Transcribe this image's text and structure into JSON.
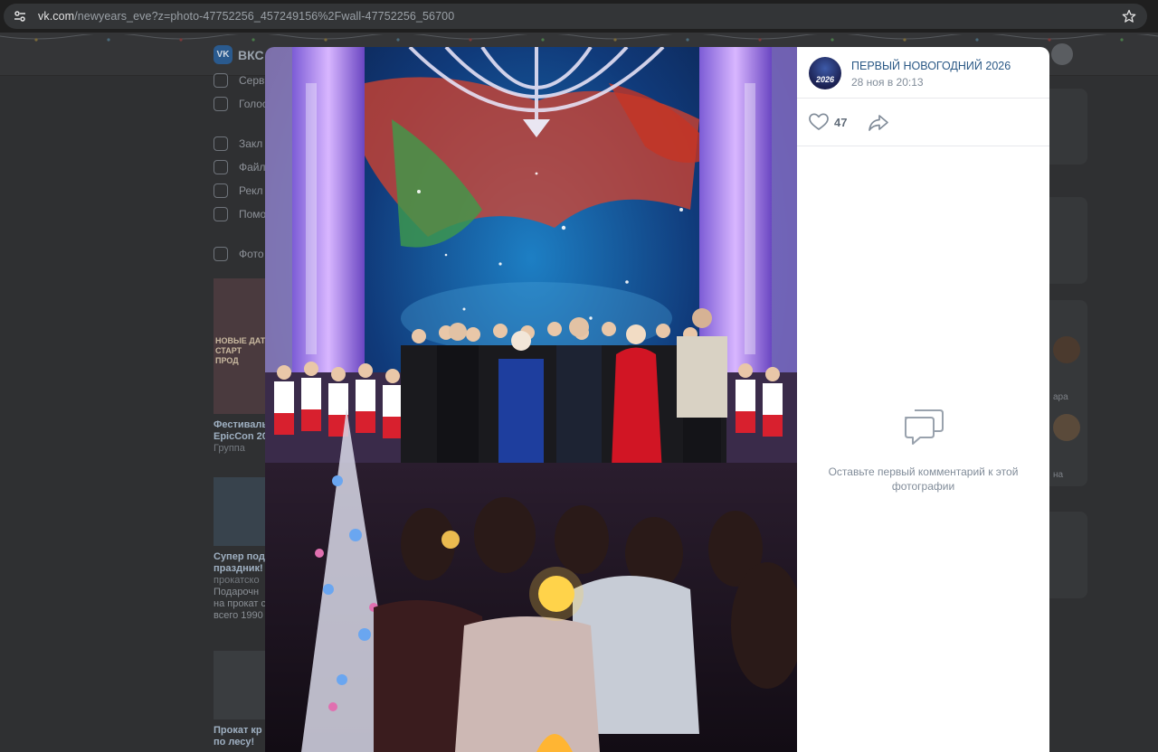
{
  "browser": {
    "url_host": "vk.com",
    "url_path": "/newyears_eve?z=photo-47752256_457249156%2Fwall-47752256_56700"
  },
  "vk_background": {
    "logo_text": "ВКС",
    "menu": [
      {
        "label": "Серв"
      },
      {
        "label": "Голос"
      },
      {
        "label": "Закл"
      },
      {
        "label": "Файл"
      },
      {
        "label": "Рекл"
      },
      {
        "label": "Помо"
      },
      {
        "label": "Фото"
      }
    ],
    "ads": [
      {
        "banner": "НОВЫЕ ДАТ СТАРТ ПРОД",
        "title1": "Фестиваль",
        "title2": "EpicCon 20",
        "sub": "Группа"
      },
      {
        "title1": "Супер пода",
        "title2": "праздник!",
        "sub": "прокатско",
        "body1": "Подарочн",
        "body2": "на прокат с",
        "body3": "всего 1990"
      },
      {
        "title1": "Прокат кр",
        "title2": "по лесу!"
      }
    ],
    "right_labels": [
      "ара",
      "на"
    ]
  },
  "post": {
    "group_name": "ПЕРВЫЙ НОВОГОДНИЙ 2026",
    "avatar_text": "2026",
    "date": "28 ноя в 20:13",
    "likes": "47",
    "empty_comments": "Оставьте первый комментарий к этой фотографии"
  }
}
